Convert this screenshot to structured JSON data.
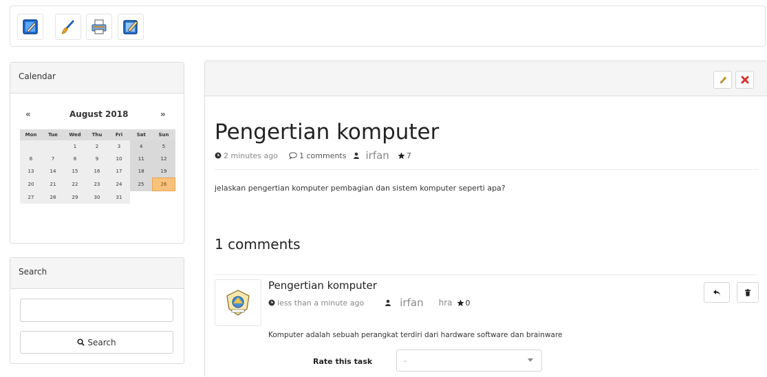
{
  "toolbar": {
    "buttons": [
      {
        "name": "edit-document-icon"
      },
      {
        "name": "brush-icon"
      },
      {
        "name": "printer-icon"
      },
      {
        "name": "compose-icon"
      }
    ]
  },
  "calendar": {
    "heading": "Calendar",
    "prev": "«",
    "next": "»",
    "month_label": "August 2018",
    "weekdays": [
      "Mon",
      "Tue",
      "Wed",
      "Thu",
      "Fri",
      "Sat",
      "Sun"
    ],
    "today": "26"
  },
  "search": {
    "heading": "Search",
    "button_label": "Search",
    "input_value": ""
  },
  "post": {
    "title": "Pengertian komputer",
    "time": "2 minutes ago",
    "comments_count": "1 comments",
    "author": "irfan",
    "stars": "7",
    "body": "jelaskan pengertian komputer pembagian dan sistem komputer seperti apa?"
  },
  "comments_section": {
    "title": "1 comments",
    "items": [
      {
        "title": "Pengertian komputer",
        "time": "less than a minute ago",
        "author": "irfan",
        "tag": "hra",
        "stars": "0",
        "text": "Komputer adalah sebuah perangkat terdiri dari hardware software dan brainware"
      }
    ]
  },
  "rating": {
    "label": "Rate this task",
    "selected": "-"
  },
  "colors": {
    "accent_today": "#f9c27c",
    "delete_red": "#d9302c",
    "edit_yellow": "#e0a82e"
  }
}
